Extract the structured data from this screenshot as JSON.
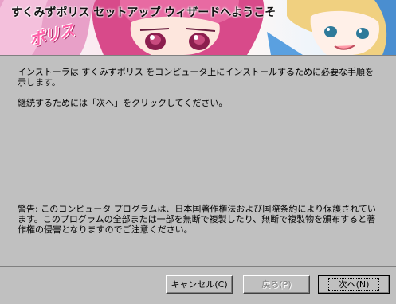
{
  "wizard": {
    "title": "すくみずポリス セットアップ ウィザードへようこそ",
    "logo": "ポリス",
    "intro": "インストーラは すくみずポリス をコンピュータ上にインストールするために必要な手順を示します。",
    "continue": "継続するためには「次へ」をクリックしてください。",
    "warning": "警告: このコンピュータ プログラムは、日本国著作権法および国際条約により保護されています。このプログラムの全部または一部を無断で複製したり、無断で複製物を頒布すると著作権の侵害となりますのでご注意ください。"
  },
  "buttons": {
    "cancel": "キャンセル(C)",
    "back": "戻る(P)",
    "next": "次へ(N)"
  },
  "colors": {
    "dialog_bg": "#c0c0c0",
    "banner_accent": "#ff60a8"
  }
}
